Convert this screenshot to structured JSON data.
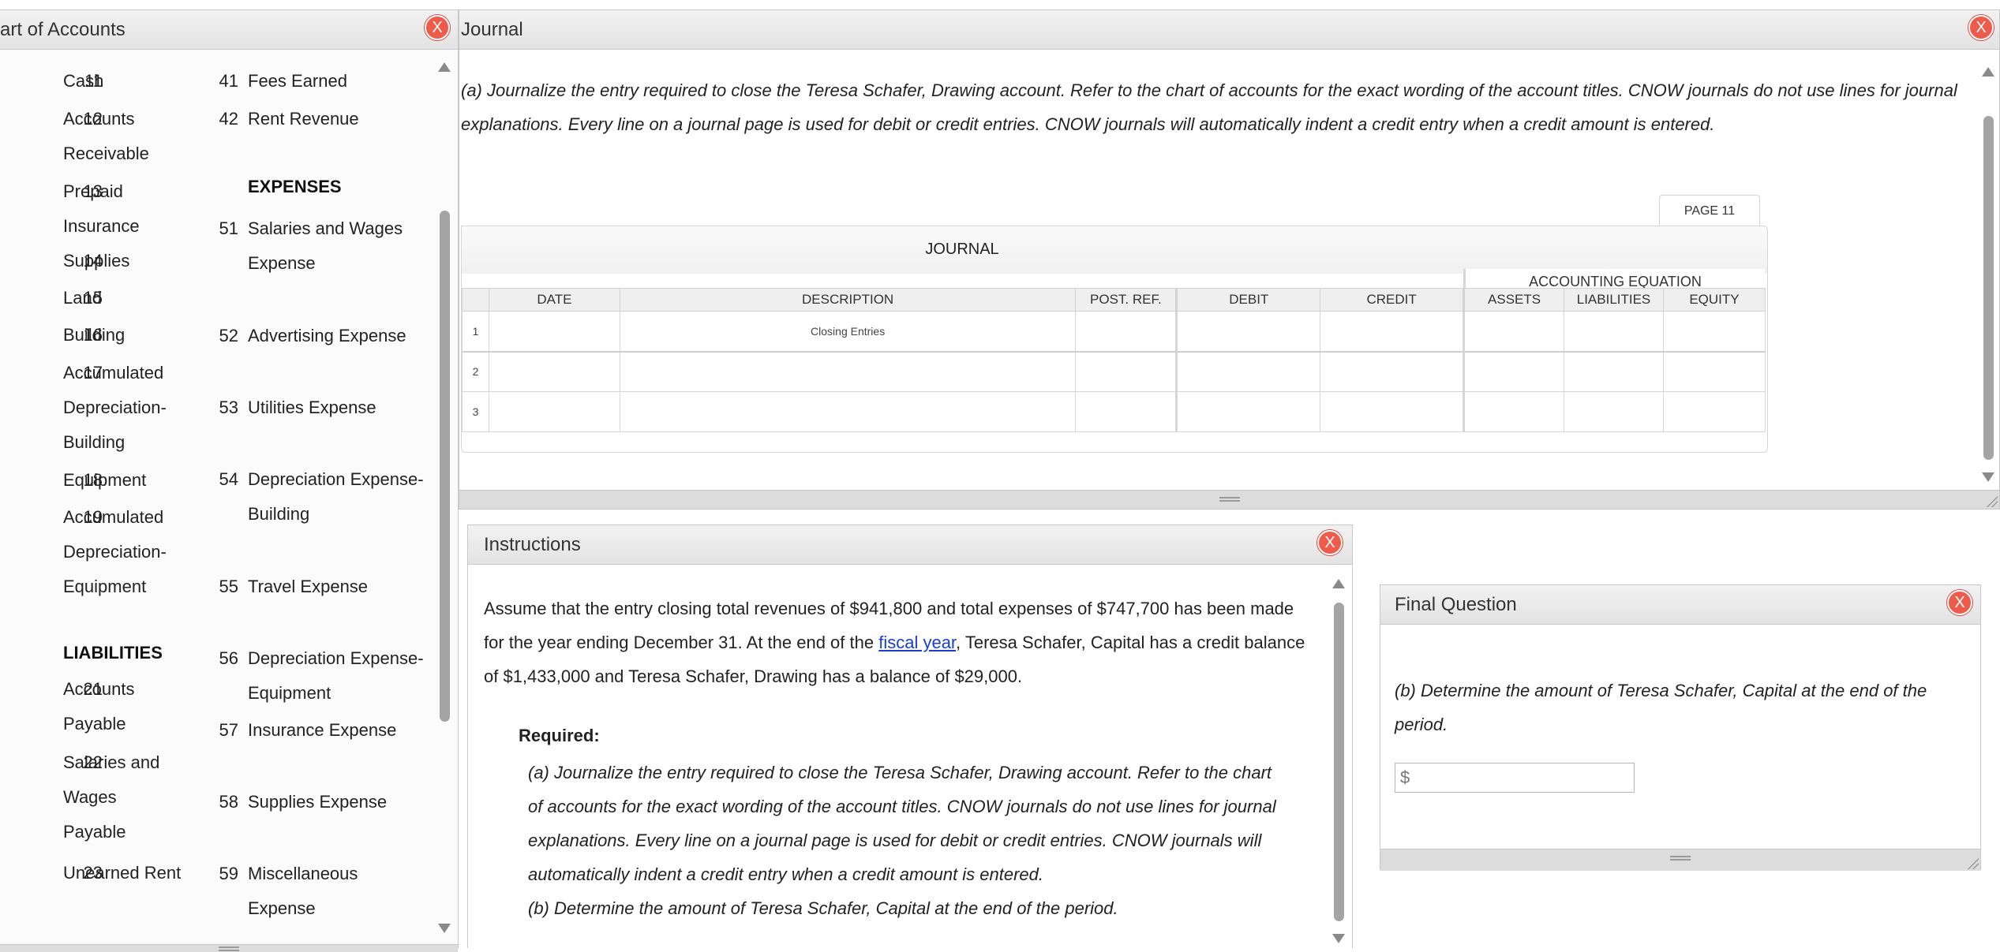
{
  "chart_of_accounts": {
    "title": "art of Accounts",
    "close_label": "X",
    "left_column": [
      {
        "num": "11",
        "label": "Cash"
      },
      {
        "num": "12",
        "label": "Accounts Receivable"
      },
      {
        "num": "13",
        "label": "Prepaid Insurance"
      },
      {
        "num": "14",
        "label": "Supplies"
      },
      {
        "num": "15",
        "label": "Land"
      },
      {
        "num": "16",
        "label": "Building"
      },
      {
        "num": "17",
        "label": "Accumulated Depreciation-Building"
      },
      {
        "num": "18",
        "label": "Equipment"
      },
      {
        "num": "19",
        "label": "Accumulated Depreciation-Equipment"
      },
      {
        "heading": "LIABILITIES"
      },
      {
        "num": "21",
        "label": "Accounts Payable"
      },
      {
        "num": "22",
        "label": "Salaries and Wages Payable"
      },
      {
        "num": "23",
        "label": "Unearned Rent"
      }
    ],
    "right_column": [
      {
        "num": "41",
        "label": "Fees Earned"
      },
      {
        "num": "42",
        "label": "Rent Revenue"
      },
      {
        "heading": "EXPENSES"
      },
      {
        "num": "51",
        "label": "Salaries and Wages Expense"
      },
      {
        "num": "52",
        "label": "Advertising Expense"
      },
      {
        "num": "53",
        "label": "Utilities Expense"
      },
      {
        "num": "54",
        "label": "Depreciation Expense-Building"
      },
      {
        "num": "55",
        "label": "Travel Expense"
      },
      {
        "num": "56",
        "label": "Depreciation Expense-Equipment"
      },
      {
        "num": "57",
        "label": "Insurance Expense"
      },
      {
        "num": "58",
        "label": "Supplies Expense"
      },
      {
        "num": "59",
        "label": "Miscellaneous Expense"
      }
    ]
  },
  "journal_panel": {
    "title": "Journal",
    "close_label": "X",
    "instruction": "(a) Journalize the entry required to close the Teresa Schafer, Drawing account. Refer to the chart of accounts for the exact wording of the account titles. CNOW journals do not use lines for journal explanations. Every line on a journal page is used for debit or credit entries. CNOW journals will automatically indent a credit entry when a credit amount is entered.",
    "page_tab": "PAGE 11",
    "journal_title": "JOURNAL",
    "accounting_equation_label": "ACCOUNTING EQUATION",
    "columns": [
      "DATE",
      "DESCRIPTION",
      "POST. REF.",
      "DEBIT",
      "CREDIT",
      "ASSETS",
      "LIABILITIES",
      "EQUITY"
    ],
    "rows": [
      {
        "num": "1",
        "description": "Closing Entries"
      },
      {
        "num": "2",
        "description": ""
      },
      {
        "num": "3",
        "description": ""
      }
    ]
  },
  "instructions_panel": {
    "title": "Instructions",
    "close_label": "X",
    "para_before_link": "Assume that the entry closing total revenues of $941,800 and total expenses of $747,700 has been made for the year ending December 31. At the end of the ",
    "link_text": "fiscal year",
    "para_after_link": ", Teresa Schafer, Capital has a credit balance of $1,433,000 and Teresa Schafer, Drawing has a balance of $29,000.",
    "required_label": "Required:",
    "req_a": "(a) Journalize the entry required to close the Teresa Schafer, Drawing account. Refer to the chart of accounts for the exact wording of the account titles. CNOW journals do not use lines for journal explanations. Every line on a journal page is used for debit or credit entries. CNOW journals will automatically indent a credit entry when a credit amount is entered.",
    "req_b": "(b) Determine the amount of Teresa Schafer, Capital at the end of the period."
  },
  "final_question": {
    "title": "Final Question",
    "close_label": "X",
    "question": "(b) Determine the amount of Teresa Schafer, Capital at the end of the period.",
    "currency_symbol": "$",
    "answer_value": ""
  }
}
